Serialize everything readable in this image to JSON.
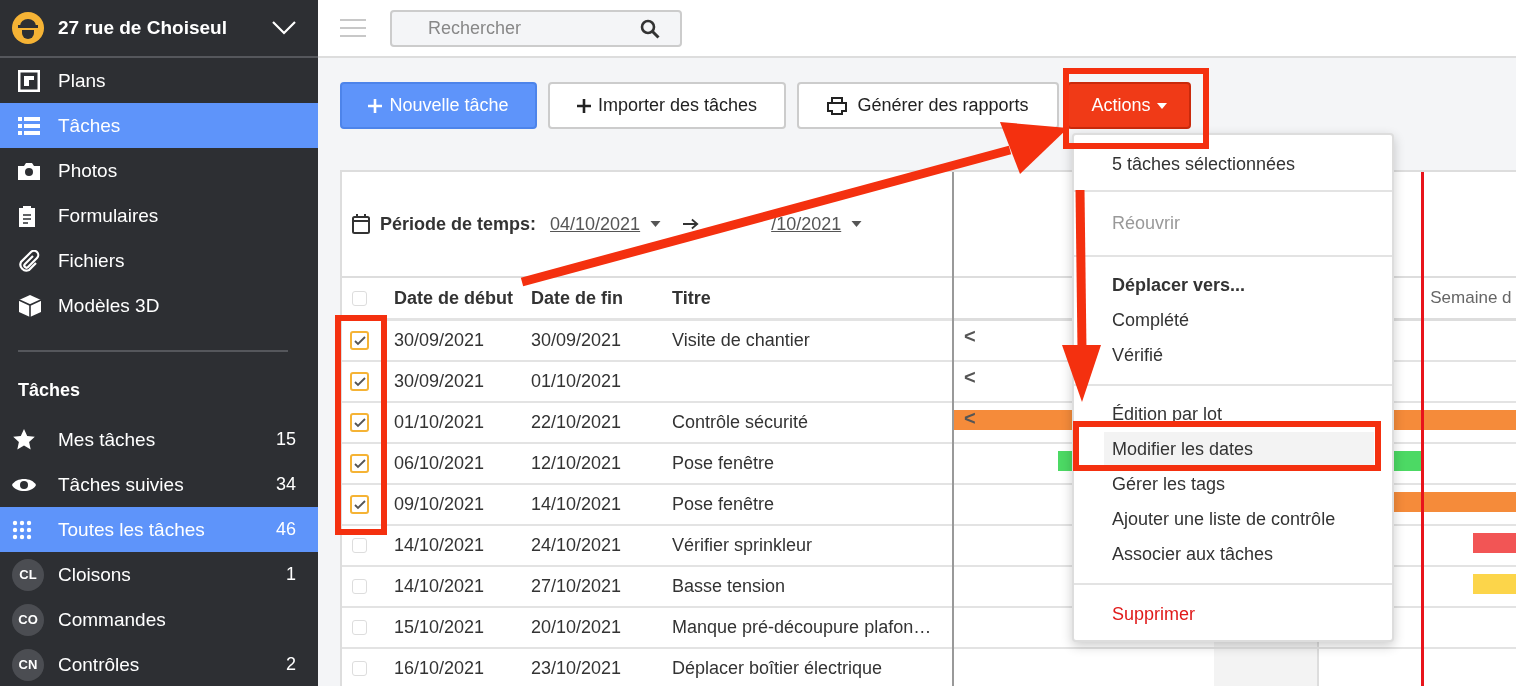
{
  "sidebar": {
    "project": "27 rue de Choiseul",
    "nav": [
      {
        "label": "Plans",
        "selected": false
      },
      {
        "label": "Tâches",
        "selected": true
      },
      {
        "label": "Photos",
        "selected": false
      },
      {
        "label": "Formulaires",
        "selected": false
      },
      {
        "label": "Fichiers",
        "selected": false
      },
      {
        "label": "Modèles 3D",
        "selected": false
      }
    ],
    "section_title": "Tâches",
    "filters": [
      {
        "label": "Mes tâches",
        "count": "15",
        "selected": false
      },
      {
        "label": "Tâches suivies",
        "count": "34",
        "selected": false
      },
      {
        "label": "Toutes les tâches",
        "count": "46",
        "selected": true
      },
      {
        "badge": "CL",
        "label": "Cloisons",
        "count": "1",
        "selected": false
      },
      {
        "badge": "CO",
        "label": "Commandes",
        "selected": false
      },
      {
        "badge": "CN",
        "label": "Contrôles",
        "count": "2",
        "selected": false
      }
    ]
  },
  "search": {
    "placeholder": "Rechercher"
  },
  "toolbar": {
    "buttons": [
      {
        "label": "Nouvelle tâche",
        "kind": "primary"
      },
      {
        "label": "Importer des tâches",
        "kind": "import"
      },
      {
        "label": "Générer des rapports",
        "kind": "print"
      }
    ],
    "actions": "Actions"
  },
  "period": {
    "label": "Période de temps:",
    "start": "04/10/2021",
    "end": "/10/2021"
  },
  "table": {
    "columns": [
      "Date de début",
      "Date de fin",
      "Titre"
    ],
    "all_checked": false,
    "rows": [
      {
        "checked": true,
        "start": "30/09/2021",
        "end": "30/09/2021",
        "title": "Visite de chantier",
        "marker": "<"
      },
      {
        "checked": true,
        "start": "30/09/2021",
        "end": "01/10/2021",
        "marker": "<"
      },
      {
        "checked": true,
        "start": "01/10/2021",
        "end": "22/10/2021",
        "title": "Contrôle sécurité",
        "marker": "<",
        "color": "#f58b3a"
      },
      {
        "checked": true,
        "start": "06/10/2021",
        "end": "12/10/2021",
        "title": "Pose fenêtre",
        "color": "#4cd964"
      },
      {
        "checked": true,
        "start": "09/10/2021",
        "end": "14/10/2021",
        "title": "Pose fenêtre",
        "color": "#f58b3a"
      },
      {
        "checked": false,
        "start": "14/10/2021",
        "end": "24/10/2021",
        "title": "Vérifier sprinkleur",
        "color": "#f25555"
      },
      {
        "checked": false,
        "start": "14/10/2021",
        "end": "27/10/2021",
        "title": "Basse tension",
        "color": "#fcd54a"
      },
      {
        "checked": false,
        "start": "15/10/2021",
        "end": "20/10/2021",
        "title": "Manque pré-découpure plafon…"
      },
      {
        "checked": false,
        "start": "16/10/2021",
        "end": "23/10/2021",
        "title": "Déplacer boîtier électrique"
      }
    ]
  },
  "gantt": {
    "week_label": "Semaine d"
  },
  "menu": {
    "groups": [
      [
        {
          "label": "5 tâches sélectionnées",
          "kind": "normal",
          "selected": false
        }
      ],
      [
        {
          "label": "Réouvrir",
          "kind": "disabled",
          "selected": false
        }
      ],
      [
        {
          "label": "Déplacer vers...",
          "kind": "heading",
          "selected": false
        },
        {
          "label": "Complété",
          "kind": "normal",
          "selected": false
        },
        {
          "label": "Vérifié",
          "kind": "normal",
          "selected": false
        }
      ],
      [
        {
          "label": "Édition par lot",
          "kind": "normal",
          "selected": false
        },
        {
          "label": "Modifier les dates",
          "kind": "normal",
          "selected": true
        },
        {
          "label": "Gérer les tags",
          "kind": "normal",
          "selected": false
        },
        {
          "label": "Ajouter une liste de contrôle",
          "kind": "normal",
          "selected": false
        },
        {
          "label": "Associer aux tâches",
          "kind": "normal",
          "selected": false
        }
      ],
      [
        {
          "label": "Supprimer",
          "kind": "danger",
          "selected": false
        }
      ]
    ]
  }
}
